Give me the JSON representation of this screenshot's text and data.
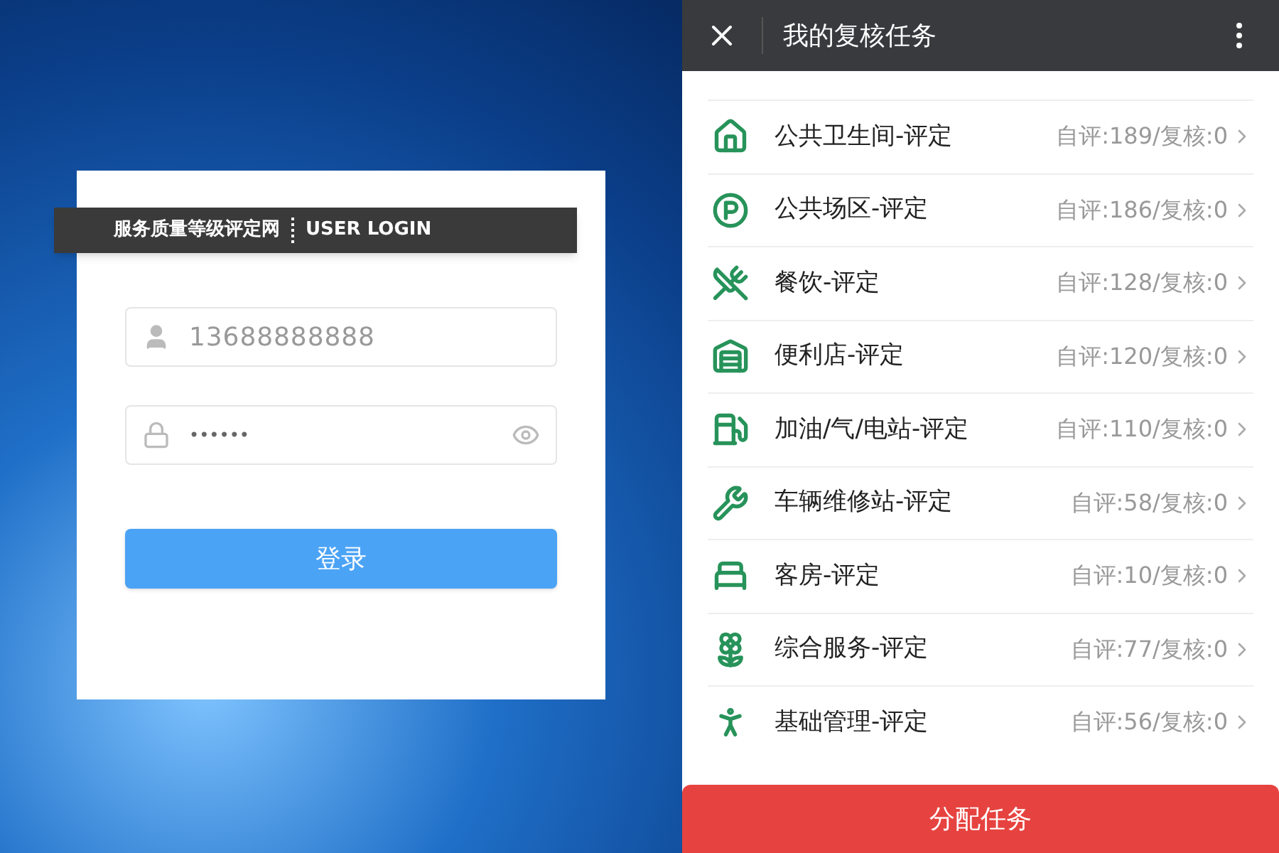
{
  "login": {
    "banner_title": "服务质量等级评定网",
    "banner_subtitle": "USER LOGIN",
    "username": {
      "value": "13688888888"
    },
    "password": {
      "value": "••••••"
    },
    "submit": "登录"
  },
  "app": {
    "title": "我的复核任务",
    "items": [
      {
        "kind": "house",
        "label": "公共卫生间-评定",
        "reading": "自评:189/复核:0"
      },
      {
        "kind": "parking",
        "label": "公共场区-评定",
        "reading": "自评:186/复核:0"
      },
      {
        "kind": "dining",
        "label": "餐饮-评定",
        "reading": "自评:128/复核:0"
      },
      {
        "kind": "store",
        "label": "便利店-评定",
        "reading": "自评:120/复核:0"
      },
      {
        "kind": "fuel",
        "label": "加油/气/电站-评定",
        "reading": "自评:110/复核:0"
      },
      {
        "kind": "wrench",
        "label": "车辆维修站-评定",
        "reading": "自评:58/复核:0"
      },
      {
        "kind": "bed",
        "label": "客房-评定",
        "reading": "自评:10/复核:0"
      },
      {
        "kind": "service",
        "label": "综合服务-评定",
        "reading": "自评:77/复核:0"
      },
      {
        "kind": "person",
        "label": "基础管理-评定",
        "reading": "自评:56/复核:0"
      }
    ],
    "action": "分配任务"
  }
}
